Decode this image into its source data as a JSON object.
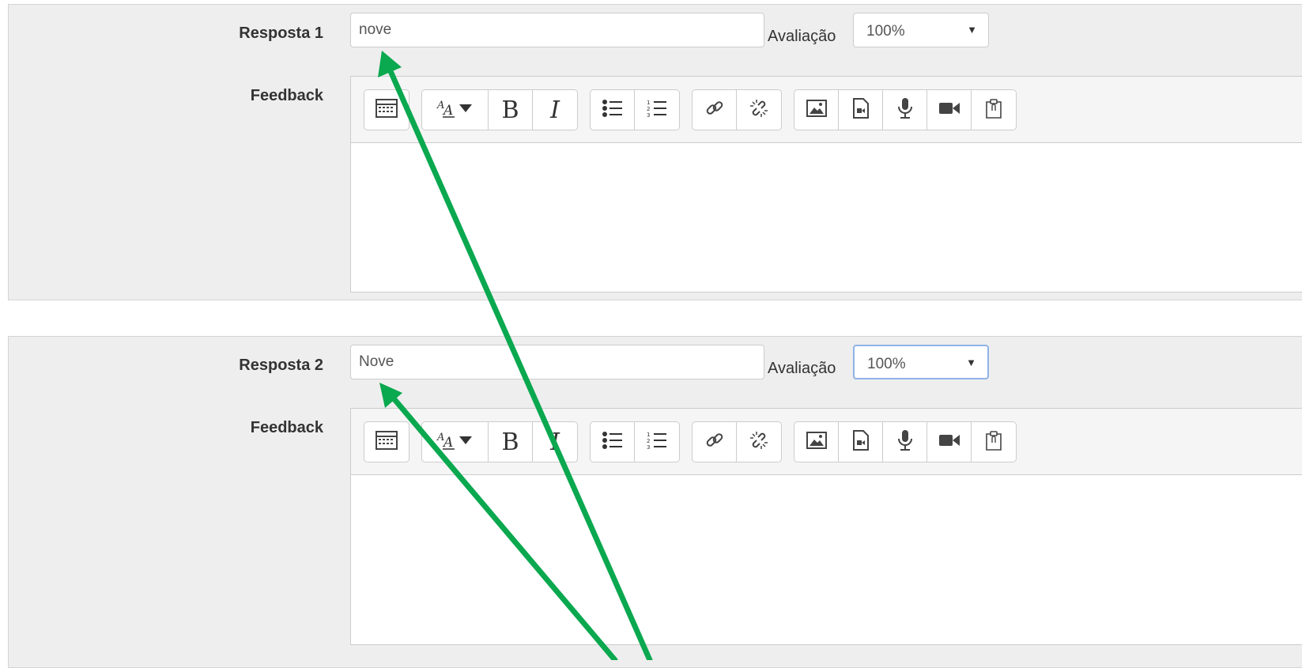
{
  "answers": [
    {
      "label": "Resposta 1",
      "value": "nove",
      "grade_label": "Avaliação",
      "grade_value": "100%",
      "feedback_label": "Feedback"
    },
    {
      "label": "Resposta 2",
      "value": "Nove",
      "grade_label": "Avaliação",
      "grade_value": "100%",
      "feedback_label": "Feedback"
    }
  ],
  "toolbar_icons": [
    "toolbar-toggle-icon",
    "font-style-icon",
    "bold-icon",
    "italic-icon",
    "bullet-list-icon",
    "numbered-list-icon",
    "link-icon",
    "unlink-icon",
    "image-icon",
    "media-icon",
    "microphone-icon",
    "video-icon",
    "paste-icon"
  ],
  "colors": {
    "annotation_arrow": "#0aa84f",
    "panel_background": "#eeeeee",
    "focus_border": "#8fb3e8"
  }
}
